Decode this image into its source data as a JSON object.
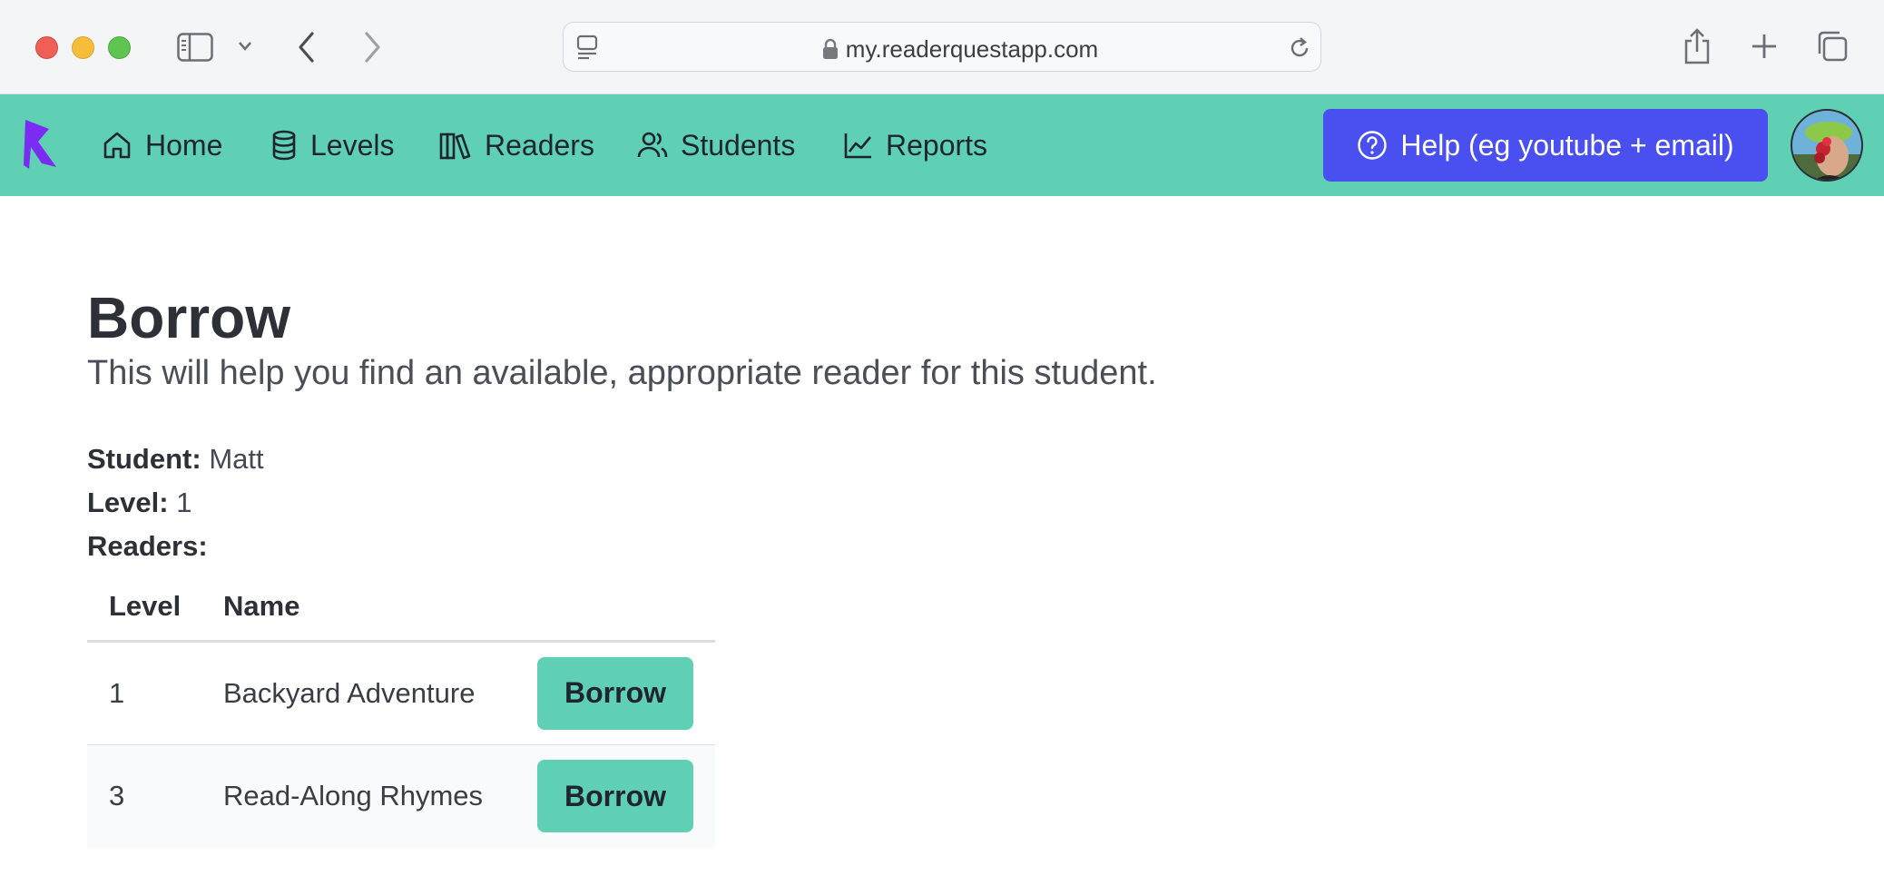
{
  "browser": {
    "url": "my.readerquestapp.com"
  },
  "nav": {
    "items": [
      {
        "label": "Home",
        "icon": "home-icon"
      },
      {
        "label": "Levels",
        "icon": "database-icon"
      },
      {
        "label": "Readers",
        "icon": "books-icon"
      },
      {
        "label": "Students",
        "icon": "users-icon"
      },
      {
        "label": "Reports",
        "icon": "chart-line-icon"
      }
    ],
    "help_label": "Help (eg youtube + email)"
  },
  "colors": {
    "nav_bg": "#5fd0b4",
    "help_bg": "#4a50f0",
    "logo": "#7b2cf2"
  },
  "page": {
    "title": "Borrow",
    "subtitle": "This will help you find an available, appropriate reader for this student.",
    "student_label": "Student:",
    "student_value": "Matt",
    "level_label": "Level:",
    "level_value": "1",
    "readers_label": "Readers:"
  },
  "table": {
    "headers": [
      "Level",
      "Name"
    ],
    "rows": [
      {
        "level": "1",
        "name": "Backyard Adventure",
        "action": "Borrow"
      },
      {
        "level": "3",
        "name": "Read-Along Rhymes",
        "action": "Borrow"
      }
    ]
  }
}
